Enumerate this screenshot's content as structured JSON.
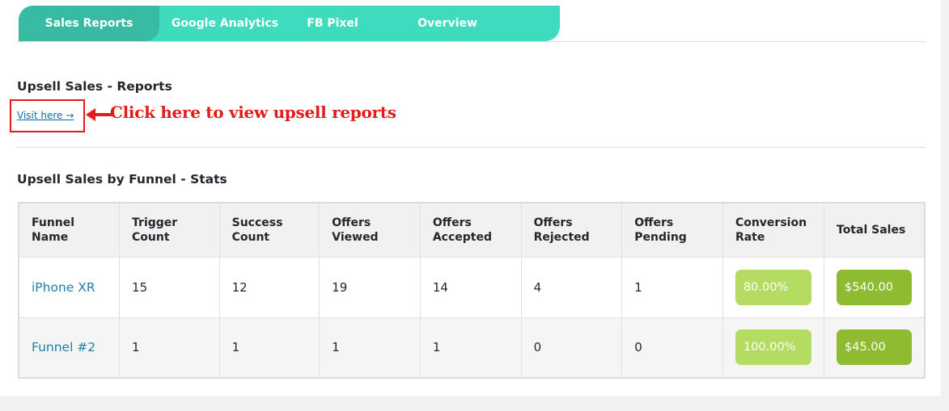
{
  "tabs": [
    {
      "label": "Sales Reports",
      "active": true
    },
    {
      "label": "Google Analytics",
      "active": false
    },
    {
      "label": "FB Pixel",
      "active": false
    },
    {
      "label": "Overview",
      "active": false
    }
  ],
  "reports": {
    "title": "Upsell Sales - Reports",
    "visit_link": "Visit here →",
    "annotation": "Click here to view upsell reports"
  },
  "stats": {
    "title": "Upsell Sales by Funnel - Stats",
    "columns": [
      {
        "line1": "Funnel Name",
        "line2": ""
      },
      {
        "line1": "Trigger",
        "line2": "Count"
      },
      {
        "line1": "Success",
        "line2": "Count"
      },
      {
        "line1": "Offers",
        "line2": "Viewed"
      },
      {
        "line1": "Offers",
        "line2": "Accepted"
      },
      {
        "line1": "Offers",
        "line2": "Rejected"
      },
      {
        "line1": "Offers",
        "line2": "Pending"
      },
      {
        "line1": "Conversion",
        "line2": "Rate"
      },
      {
        "line1": "Total Sales",
        "line2": ""
      }
    ],
    "rows": [
      {
        "funnel": "iPhone XR",
        "trigger": "15",
        "success": "12",
        "viewed": "19",
        "accepted": "14",
        "rejected": "4",
        "pending": "1",
        "rate": "80.00%",
        "sales": "$540.00"
      },
      {
        "funnel": "Funnel #2",
        "trigger": "1",
        "success": "1",
        "viewed": "1",
        "accepted": "1",
        "rejected": "0",
        "pending": "0",
        "rate": "100.00%",
        "sales": "$45.00"
      }
    ]
  },
  "colors": {
    "tab_bar": "#3fdbbf",
    "tab_active": "#38bba2",
    "annotation": "#e31b1b",
    "link": "#1f7fa8",
    "rate_pill": "#b4dc63",
    "sales_pill": "#8ebb30"
  }
}
